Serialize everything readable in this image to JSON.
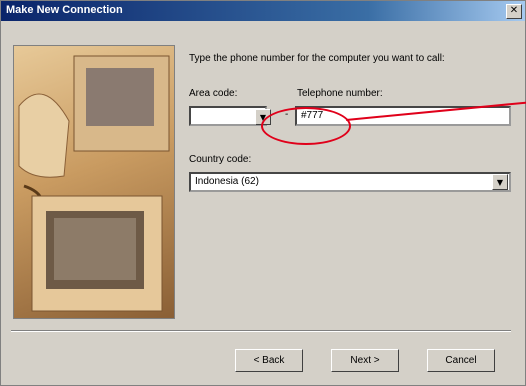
{
  "window": {
    "title": "Make New Connection",
    "close_icon": "close-icon"
  },
  "instruction": "Type the phone number for the computer you want to call:",
  "area_code": {
    "label": "Area code:",
    "value": ""
  },
  "telephone": {
    "label": "Telephone number:",
    "value": "#777"
  },
  "country": {
    "label": "Country code:",
    "value": "Indonesia (62)"
  },
  "buttons": {
    "back": "< Back",
    "next": "Next >",
    "cancel": "Cancel"
  },
  "annotation_color": "#e0001a"
}
